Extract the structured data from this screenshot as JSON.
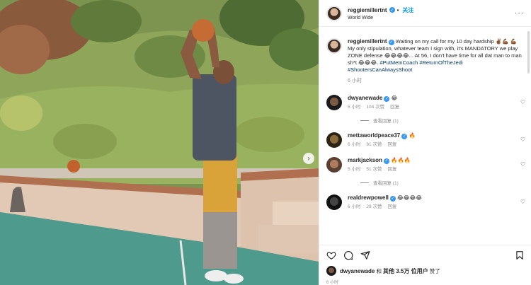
{
  "post": {
    "author": "reggiemillertnt",
    "follow_label": "关注",
    "location": "World Wide",
    "more_glyph": "···"
  },
  "caption": {
    "username": "reggiemillertnt",
    "text_1": "Waiting on my call for my 10 day hardship ✌🏾💪🏾",
    "text_2": "💪🏾 My only stipulation, whatever team I sign with, it's MANDATORY we play ZONE defense 😂😂😂😂... At 56, I don't have time for all dat man to man sh*t 😂😂😂. ",
    "hashtags": "#PutMeInCoach #ReturnOfTheJedi #ShootersCanAlwaysShoot",
    "time": "6 小时"
  },
  "comments": [
    {
      "username": "dwyanewade",
      "text": "😂",
      "time": "5 小时",
      "likes": "104 次赞",
      "reply_label": "回复",
      "view_replies": "查看回复 (1)"
    },
    {
      "username": "mettaworldpeace37",
      "text": "🔥",
      "time": "6 小时",
      "likes": "81 次赞",
      "reply_label": "回复"
    },
    {
      "username": "markjackson",
      "text": "🔥🔥🔥",
      "time": "5 小时",
      "likes": "51 次赞",
      "reply_label": "回复",
      "view_replies": "查看回复 (1)"
    },
    {
      "username": "realdrewpowell",
      "text": "😂😂😂😂",
      "time": "6 小时",
      "likes": "29 次赞",
      "reply_label": "回复"
    }
  ],
  "likes_line": {
    "username": "dwyanewade",
    "middle": " 和 ",
    "others": "其他 3.5万 位用户",
    "suffix": " 赞了"
  },
  "footer_time": "6 小时"
}
